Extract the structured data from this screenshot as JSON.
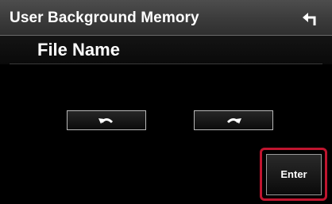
{
  "header": {
    "title": "User Background Memory",
    "back_icon": "back-arrow-icon"
  },
  "field": {
    "label": "File Name"
  },
  "controls": {
    "undo_icon": "undo-arrow-icon",
    "redo_icon": "redo-arrow-icon",
    "enter_label": "Enter"
  },
  "colors": {
    "background": "#000000",
    "header": "#3b3b3b",
    "highlight": "#c0152f",
    "text": "#ffffff"
  }
}
